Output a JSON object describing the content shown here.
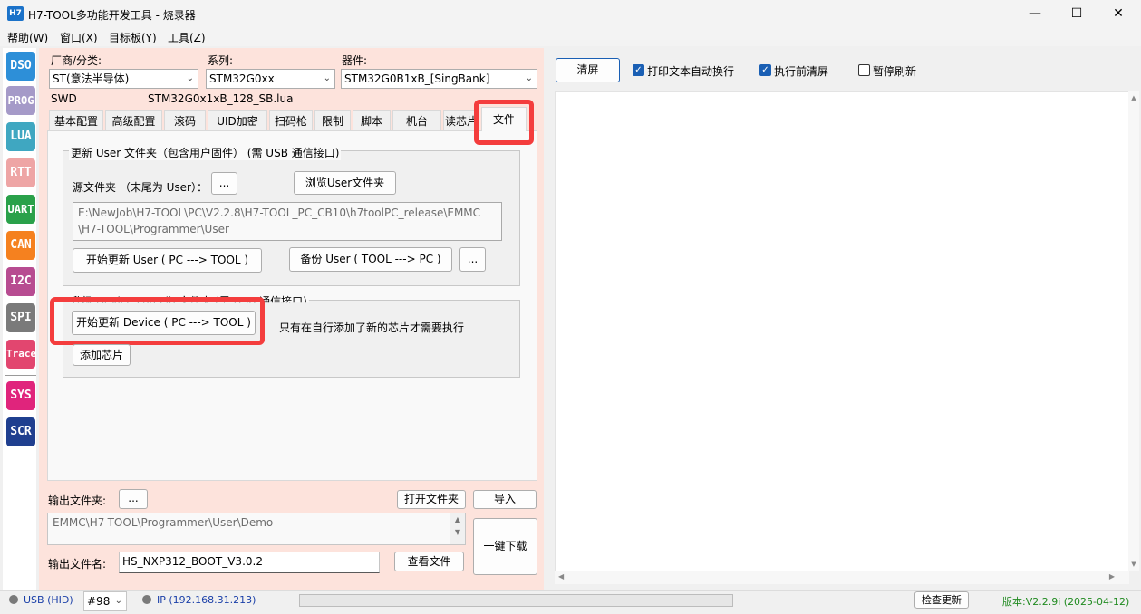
{
  "window": {
    "title": "H7-TOOL多功能开发工具 - 烧录器",
    "icon_text": "H7",
    "minimize": "—",
    "maximize": "☐",
    "close": "✕"
  },
  "menu": [
    "帮助(W)",
    "窗口(X)",
    "目标板(Y)",
    "工具(Z)"
  ],
  "toolbar": [
    {
      "label": "DSO",
      "color": "#2d8fd8"
    },
    {
      "label": "PROG",
      "color": "#a59ac8"
    },
    {
      "label": "LUA",
      "color": "#3fa7c1"
    },
    {
      "label": "RTT",
      "color": "#eea5a5"
    },
    {
      "label": "UART",
      "color": "#2aa14a"
    },
    {
      "label": "CAN",
      "color": "#f5811f"
    },
    {
      "label": "I2C",
      "color": "#b74c91"
    },
    {
      "label": "SPI",
      "color": "#7a7a7a"
    },
    {
      "label": "Trace",
      "color": "#e2466f"
    },
    {
      "label": "SYS",
      "color": "#e0247c"
    },
    {
      "label": "SCR",
      "color": "#1f3f8f"
    }
  ],
  "selectors": {
    "vendor_label": "厂商/分类:",
    "vendor_value": "ST(意法半导体)",
    "series_label": "系列:",
    "series_value": "STM32G0xx",
    "device_label": "器件:",
    "device_value": "STM32G0B1xB_[SingBank]",
    "interface": "SWD",
    "lua_file": "STM32G0x1xB_128_SB.lua"
  },
  "tabs": [
    "基本配置",
    "高级配置",
    "滚码",
    "UID加密",
    "扫码枪",
    "限制",
    "脚本",
    "机台",
    "读芯片",
    "文件"
  ],
  "active_tab": "文件",
  "group_user": {
    "title": "更新 User 文件夹（包含用户固件）     (需 USB 通信接口)",
    "source_label": "源文件夹  （末尾为 User）：",
    "dots": "...",
    "browse_btn": "浏览User文件夹",
    "path_line1": "E:\\NewJob\\H7-TOOL\\PC\\V2.2.8\\H7-TOOL_PC_CB10\\h7toolPC_release\\EMMC",
    "path_line2": "\\H7-TOOL\\Programmer\\User",
    "start_btn": "开始更新 User ( PC ---> TOOL )",
    "backup_btn": "备份 User ( TOOL ---> PC )",
    "backup_dots": "..."
  },
  "group_device": {
    "title": "升级 Device     Lua Lib 文件夹      (需 USB 通信接口)",
    "start_btn": "开始更新 Device ( PC ---> TOOL )",
    "hint": "只有在自行添加了新的芯片才需要执行",
    "add_btn": "添加芯片"
  },
  "output": {
    "folder_label": "输出文件夹:",
    "folder_dots": "...",
    "open_btn": "打开文件夹",
    "import_btn": "导入",
    "path": "EMMC\\H7-TOOL\\Programmer\\User\\Demo",
    "filename_label": "输出文件名:",
    "filename_value": "HS_NXP312_BOOT_V3.0.2",
    "view_btn": "查看文件",
    "download_btn": "一键下载"
  },
  "right": {
    "clear_btn": "清屏",
    "chk_wrap": "打印文本自动换行",
    "chk_wrap_checked": true,
    "chk_clear": "执行前清屏",
    "chk_clear_checked": true,
    "chk_pause": "暂停刷新",
    "chk_pause_checked": false
  },
  "status": {
    "usb": "USB (HID)",
    "port": "#98",
    "ip": "IP (192.168.31.213)",
    "update_btn": "检查更新",
    "version": "版本:V2.2.9i (2025-04-12)"
  },
  "colors": {
    "panel_bg": "#fde3dc",
    "highlight": "#f43d3d",
    "accent": "#1a5fb4",
    "version_text": "#1f8a1f",
    "ip_text": "#1a3fa8"
  }
}
